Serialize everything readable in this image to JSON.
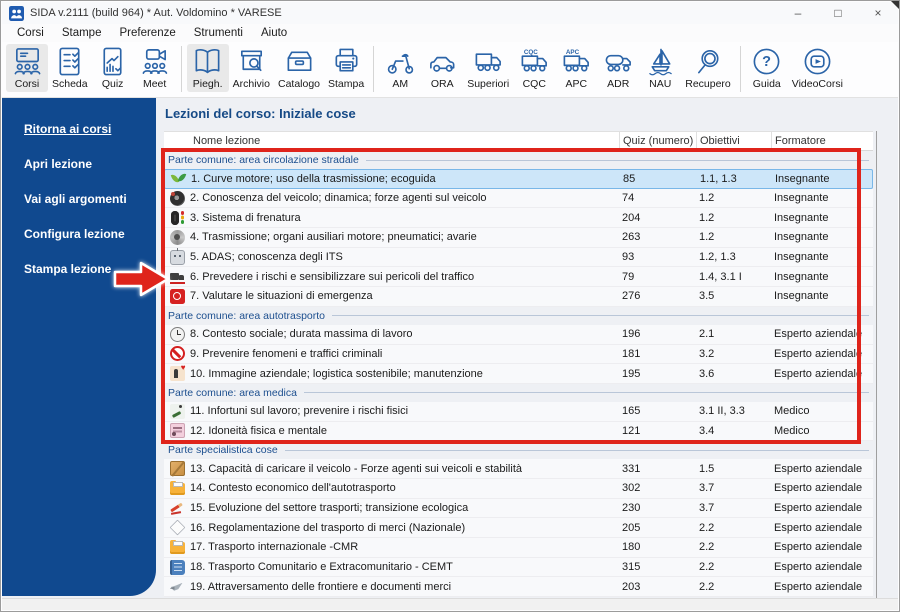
{
  "window": {
    "title": "SIDA v.2111 (build 964) * Aut. Voldomino * VARESE",
    "controls": [
      "minimize",
      "maximize",
      "close"
    ]
  },
  "menu": {
    "items": [
      "Corsi",
      "Stampe",
      "Preferenze",
      "Strumenti",
      "Aiuto"
    ]
  },
  "toolbar": {
    "groups": [
      {
        "buttons": [
          {
            "label": "Corsi",
            "icon": "course-presentation-icon",
            "active": true
          },
          {
            "label": "Scheda",
            "icon": "checklist-sheet-icon",
            "active": false
          },
          {
            "label": "Quiz",
            "icon": "quiz-stats-icon",
            "active": false
          },
          {
            "label": "Meet",
            "icon": "video-meeting-icon",
            "active": false
          }
        ]
      },
      {
        "buttons": [
          {
            "label": "Piegh.",
            "icon": "open-book-icon",
            "active": true
          },
          {
            "label": "Archivio",
            "icon": "archive-search-icon",
            "active": false
          },
          {
            "label": "Catalogo",
            "icon": "catalog-box-icon",
            "active": false
          },
          {
            "label": "Stampa",
            "icon": "printer-icon",
            "active": false
          }
        ]
      },
      {
        "buttons": [
          {
            "label": "AM",
            "icon": "scooter-icon",
            "active": false
          },
          {
            "label": "ORA",
            "icon": "car-icon",
            "active": false
          },
          {
            "label": "Superiori",
            "icon": "truck-icon",
            "active": false
          },
          {
            "label": "CQC",
            "icon": "truck-cqc-icon",
            "active": false
          },
          {
            "label": "APC",
            "icon": "truck-apc-icon",
            "active": false
          },
          {
            "label": "ADR",
            "icon": "tanker-truck-icon",
            "active": false
          },
          {
            "label": "NAU",
            "icon": "sailboat-icon",
            "active": false
          },
          {
            "label": "Recupero",
            "icon": "magnifier-icon",
            "active": false
          }
        ]
      },
      {
        "buttons": [
          {
            "label": "Guida",
            "icon": "help-circle-icon",
            "active": false
          },
          {
            "label": "VideoCorsi",
            "icon": "video-play-icon",
            "active": false
          }
        ]
      }
    ]
  },
  "sidebar": {
    "items": [
      {
        "label": "Ritorna ai corsi",
        "underlined": true
      },
      {
        "label": "Apri lezione",
        "underlined": false
      },
      {
        "label": "Vai agli argomenti",
        "underlined": false
      },
      {
        "label": "Configura lezione",
        "underlined": false
      },
      {
        "label": "Stampa lezione",
        "underlined": false
      }
    ]
  },
  "main": {
    "title": "Lezioni del corso: Iniziale cose",
    "table": {
      "columns": [
        "Nome lezione",
        "Quiz (numero)",
        "Obiettivi",
        "Formatore"
      ],
      "sections": [
        {
          "header": "Parte comune: area circolazione stradale",
          "rows": [
            {
              "icon": "eco-leaves-icon",
              "name": "1. Curve motore; uso della trasmissione; ecoguida",
              "quiz": "85",
              "obiettivi": "1.1, 1.3",
              "formatore": "Insegnante",
              "selected": true
            },
            {
              "icon": "steering-wheel-icon",
              "name": "2. Conoscenza del veicolo; dinamica; forze agenti sul veicolo",
              "quiz": "74",
              "obiettivi": "1.2",
              "formatore": "Insegnante",
              "selected": false
            },
            {
              "icon": "tire-trafficlight-icon",
              "name": "3. Sistema di frenatura",
              "quiz": "204",
              "obiettivi": "1.2",
              "formatore": "Insegnante",
              "selected": false
            },
            {
              "icon": "engine-parts-icon",
              "name": "4. Trasmissione; organi ausiliari motore; pneumatici; avarie",
              "quiz": "263",
              "obiettivi": "1.2",
              "formatore": "Insegnante",
              "selected": false
            },
            {
              "icon": "adas-robot-icon",
              "name": "5. ADAS; conoscenza degli ITS",
              "quiz": "93",
              "obiettivi": "1.2, 1.3",
              "formatore": "Insegnante",
              "selected": false
            },
            {
              "icon": "truck-hazard-icon",
              "name": "6. Prevedere i rischi e sensibilizzare sui pericoli del traffico",
              "quiz": "79",
              "obiettivi": "1.4, 3.1 I",
              "formatore": "Insegnante",
              "selected": false
            },
            {
              "icon": "emergency-sign-icon",
              "name": "7. Valutare le situazioni di emergenza",
              "quiz": "276",
              "obiettivi": "3.5",
              "formatore": "Insegnante",
              "selected": false
            }
          ]
        },
        {
          "header": "Parte comune: area autotrasporto",
          "rows": [
            {
              "icon": "work-clock-icon",
              "name": "8. Contesto sociale; durata massima di lavoro",
              "quiz": "196",
              "obiettivi": "2.1",
              "formatore": "Esperto aziendale",
              "selected": false
            },
            {
              "icon": "prohibition-sign-icon",
              "name": "9. Prevenire fenomeni e traffici criminali",
              "quiz": "181",
              "obiettivi": "3.2",
              "formatore": "Esperto aziendale",
              "selected": false
            },
            {
              "icon": "person-heart-icon",
              "name": "10. Immagine aziendale; logistica sostenibile; manutenzione",
              "quiz": "195",
              "obiettivi": "3.6",
              "formatore": "Esperto aziendale",
              "selected": false
            }
          ]
        },
        {
          "header": "Parte comune: area medica",
          "rows": [
            {
              "icon": "slip-injury-icon",
              "name": "11. Infortuni sul lavoro; prevenire i rischi fisici",
              "quiz": "165",
              "obiettivi": "3.1 II, 3.3",
              "formatore": "Medico",
              "selected": false
            },
            {
              "icon": "medical-fitness-icon",
              "name": "12. Idoneità fisica e mentale",
              "quiz": "121",
              "obiettivi": "3.4",
              "formatore": "Medico",
              "selected": false
            }
          ]
        },
        {
          "header": "Parte specialistica cose",
          "rows": [
            {
              "icon": "cargo-package-icon",
              "name": "13. Capacità di caricare il veicolo - Forze agenti sui veicoli e stabilità",
              "quiz": "331",
              "obiettivi": "1.5",
              "formatore": "Esperto aziendale",
              "selected": false
            },
            {
              "icon": "money-folder-icon",
              "name": "14. Contesto economico dell'autotrasporto",
              "quiz": "302",
              "obiettivi": "3.7",
              "formatore": "Esperto aziendale",
              "selected": false
            },
            {
              "icon": "transition-chart-icon",
              "name": "15. Evoluzione del settore trasporti; transizione ecologica",
              "quiz": "230",
              "obiettivi": "3.7",
              "formatore": "Esperto aziendale",
              "selected": false
            },
            {
              "icon": "document-sheet-icon",
              "name": "16. Regolamentazione del trasporto di merci (Nazionale)",
              "quiz": "205",
              "obiettivi": "2.2",
              "formatore": "Esperto aziendale",
              "selected": false
            },
            {
              "icon": "document-folder-icon",
              "name": "17. Trasporto internazionale -CMR",
              "quiz": "180",
              "obiettivi": "2.2",
              "formatore": "Esperto aziendale",
              "selected": false
            },
            {
              "icon": "blue-ledger-icon",
              "name": "18. Trasporto Comunitario e Extracomunitario - CEMT",
              "quiz": "315",
              "obiettivi": "2.2",
              "formatore": "Esperto aziendale",
              "selected": false
            },
            {
              "icon": "dove-border-icon",
              "name": "19. Attraversamento delle frontiere e documenti merci",
              "quiz": "203",
              "obiettivi": "2.2",
              "formatore": "Esperto aziendale",
              "selected": false
            }
          ]
        }
      ]
    }
  },
  "annotations": {
    "highlight_box_color": "#df241b",
    "arrow_color": "#df241b",
    "arrow_points_to": "6. Prevedere i rischi e sensibilizzare sui pericoli del traffico"
  },
  "colors": {
    "sidebar_blue": "#10498f",
    "toolbar_icon_blue": "#2b64a8",
    "selected_row_bg": "#cde6f9",
    "header_text_blue": "#164a86"
  }
}
